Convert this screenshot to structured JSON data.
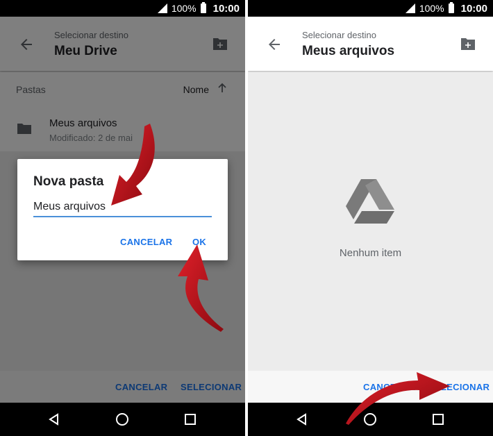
{
  "status_bar": {
    "battery_pct": "100%",
    "time": "10:00"
  },
  "left": {
    "app_bar": {
      "subtitle": "Selecionar destino",
      "title": "Meu Drive"
    },
    "list_header": {
      "column_label": "Pastas",
      "sort_label": "Nome"
    },
    "files": [
      {
        "name": "Meus arquivos",
        "meta": "Modificado: 2 de mai"
      }
    ],
    "dialog": {
      "title": "Nova pasta",
      "input_value": "Meus arquivos",
      "cancel_label": "CANCELAR",
      "ok_label": "OK"
    },
    "bottom": {
      "cancel_label": "CANCELAR",
      "select_label": "SELECIONAR"
    }
  },
  "right": {
    "app_bar": {
      "subtitle": "Selecionar destino",
      "title": "Meus arquivos"
    },
    "empty_text": "Nenhum item",
    "bottom": {
      "cancel_label": "CANCELAR",
      "select_label": "SELECIONAR"
    }
  },
  "colors": {
    "accent": "#1a73e8",
    "input_underline": "#4a90d9",
    "annotation_arrow": "#c4131c"
  },
  "icons": {
    "back": "arrow-left-icon",
    "new_folder": "create-folder-icon",
    "sort": "arrow-up-icon",
    "folder": "folder-icon",
    "drive": "google-drive-icon",
    "nav_back": "triangle-back-icon",
    "nav_home": "circle-home-icon",
    "nav_recents": "square-recents-icon"
  }
}
